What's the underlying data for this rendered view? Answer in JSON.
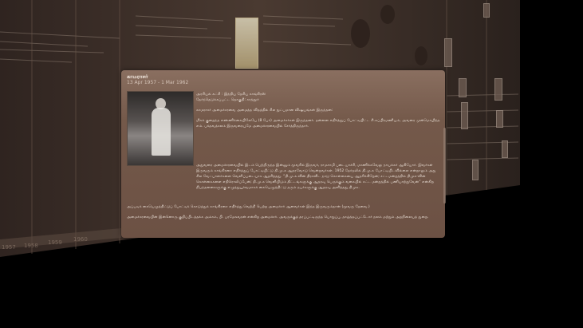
{
  "timeline": {
    "years": [
      "1957",
      "1958",
      "1959",
      "1960"
    ]
  },
  "popup": {
    "title": "காமராசர்",
    "dates": "13 Apr 1957 - 1 Mar 1962",
    "party_line": "அரசியல் கட்சி : இந்திய தேசிய காங்கிரஸ்",
    "constituency_line": "தேர்ந்தெடுக்கப்பட்ட தொகுதி: சாத்தூர்",
    "para1": "காமராசர் அமைச்சரவை அமைத்த விதத்தில் சில நுட்பமான விஷயங்கள் இருந்தன:",
    "para2": "மிகக் குறைந்த எண்ணிக்கையிலேயே (8 பேர்) அமைச்சர்கள் இருந்தனர். தன்னை எதிர்த்துப் போட்டியிட்ட சி.சுப்பிரமணியம், அவரை முன்மொழிந்த எம். பக்தவத்சலம் இருவரையுமே அமைச்சரவையில் சேர்த்திருந்தார்.",
    "para3": "அதுவரை அமைச்சரவையில் இடம் பெற்றிருந்த இன்னும் மூவரில் இருவர், ராமசாமி படையாச்சி, மாணிக்கவேலு நாயக்கர் ஆகியோர். இவர்கள் இருவரும் காங்கிரசை எதிர்த்துப் போட்டியிட்டு தி.மு.க ஆதரவோடு வென்றவர்கள். 1952 தேர்தலில் தி.மு.க போட்டியிடவில்லை என்றாலும் அது சில வேட்பாளர்களை வெளிப்படையாக ஆதரித்தது. “தி.மு.க.வின் திராவிட நாடு கொள்கையை ஆதரிக்கிறேன்; சட்டமன்றத்தில் திமுக-வின் கொள்கைகளை எதிரொலிப்பேன்; தி.மு.க வெளியிடும் திட்டங்களுக்கு ஆதரவு பெருக்கும் வகையில் சட்ட மன்றத்தில் பணியாற்றுவேன்” என்கிற நிபந்தனைகளுக்கு எழுத்துபூர்வமாகக் கையெழுத்திட்டு தரும் நபர்களுக்கு ஆதரவு அளித்தது திமுக.",
    "para4": "அப்படிக் கையெழுத்திட்டுப் போட்டிக் கொடுத்துக் காங்கிரசை எதிர்த்து வெற்றி பெற்ற அமைச்சர் ஆனவர்கள் இந்த இருவரும்தான் (மூவரு தேவை.)",
    "para5": "அமைச்சரவையின் இன்னொரு குறிப்பிடத்தக்க அம்சம், பி. பரமேசுவரன் என்கிற அமைச்சர். அவருக்குத் தரப்பட்டிருந்த பொறுப்பு, தாழ்த்தப்பட்டோர் நலம் மற்றும் அறநிலையத் துறை."
  }
}
